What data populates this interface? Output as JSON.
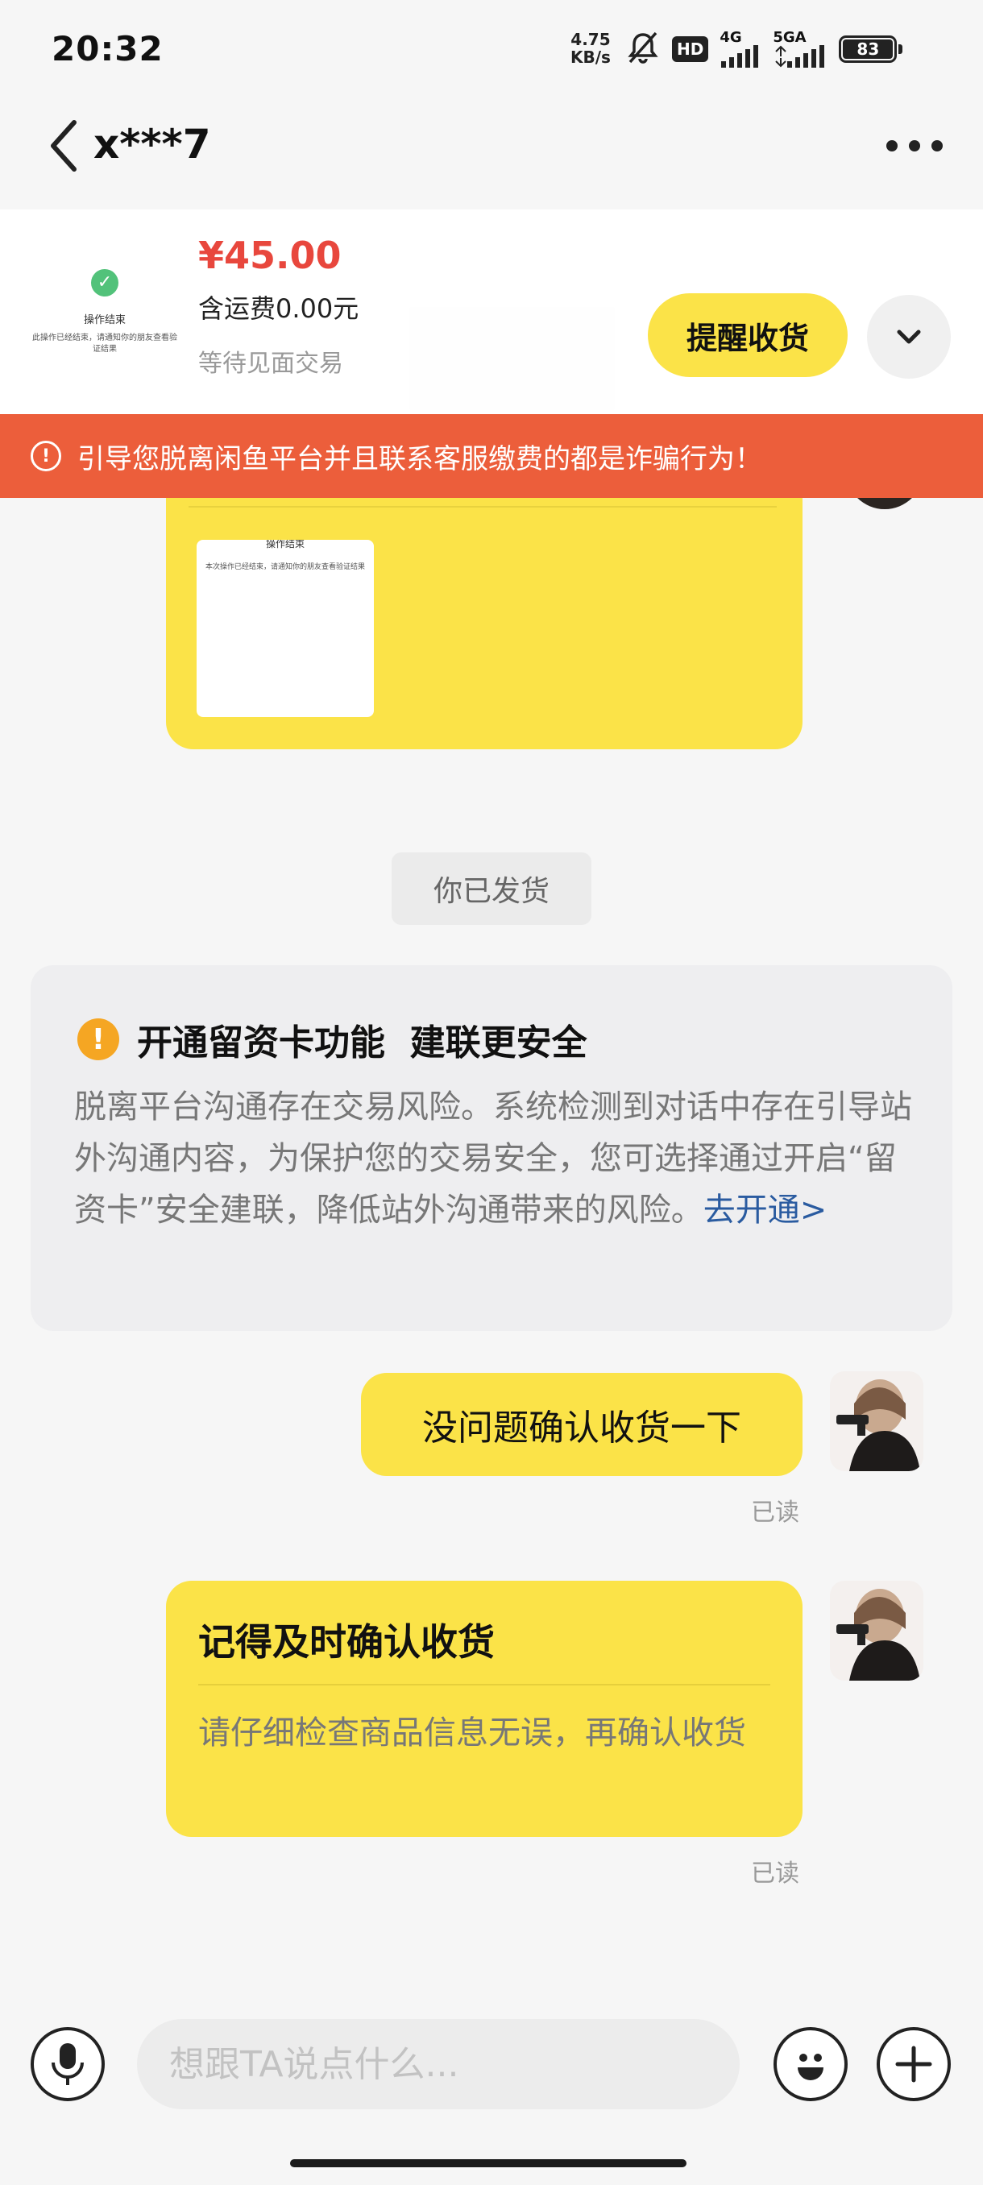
{
  "status_bar": {
    "time": "20:32",
    "net_speed_value": "4.75",
    "net_speed_unit": "KB/s",
    "hd_badge": "HD",
    "signal_1_label": "4G",
    "signal_2_label": "5GA",
    "battery": "83"
  },
  "header": {
    "title": "x***7",
    "back_icon": "chevron-left-icon",
    "more_icon": "more-dots-icon"
  },
  "product": {
    "price": "¥45.00",
    "shipping": "含运费0.00元",
    "trade_status": "等待见面交易",
    "thumb_title": "操作结束",
    "thumb_text": "此操作已经结束，请通知你的朋友查看验证结果",
    "remind_label": "提醒收货",
    "expand_icon": "chevron-down-icon"
  },
  "warning": {
    "text": "引导您脱离闲鱼平台并且联系客服缴费的都是诈骗行为！"
  },
  "messages": {
    "image_msg": {
      "screenshot_title": "操作结束",
      "screenshot_text": "本次操作已经结束，请通知你的朋友查看验证结果"
    },
    "system_notice": "你已发货",
    "info_card": {
      "title": "开通留资卡功能  建联更安全",
      "body": "脱离平台沟通存在交易风险。系统检测到对话中存在引导站外沟通内容，为保护您的交易安全，您可选择通过开启“留资卡”安全建联，降低站外沟通带来的风险。",
      "link": "去开通>"
    },
    "msg1": {
      "text": "没问题确认收货一下",
      "read": "已读"
    },
    "msg2": {
      "title": "记得及时确认收货",
      "body": "请仔细检查商品信息无误，再确认收货",
      "read": "已读"
    }
  },
  "input_bar": {
    "placeholder": "想跟TA说点什么...",
    "voice_icon": "microphone-icon",
    "emoji_icon": "emoji-icon",
    "plus_icon": "plus-icon"
  },
  "colors": {
    "accent_yellow": "#fbe348",
    "warning_red": "#ec5e3b",
    "price_red": "#e8473d",
    "link_blue": "#2a5ba0",
    "info_orange": "#f5a623"
  }
}
